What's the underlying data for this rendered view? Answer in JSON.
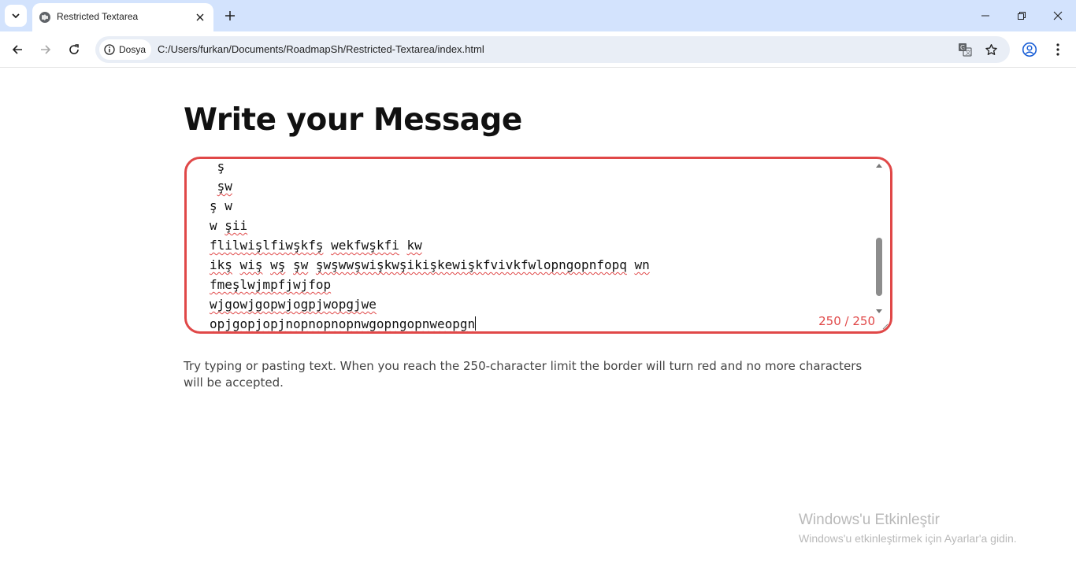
{
  "browser": {
    "tab_title": "Restricted Textarea",
    "site_chip_label": "Dosya",
    "url": "C:/Users/furkan/Documents/RoadmapSh/Restricted-Textarea/index.html"
  },
  "page": {
    "title": "Write your Message",
    "textarea_lines": [
      [
        {
          "t": " ",
          "s": false
        },
        {
          "t": "ş",
          "s": false
        }
      ],
      [
        {
          "t": " ",
          "s": false
        },
        {
          "t": "şw",
          "s": true
        }
      ],
      [
        {
          "t": "ş",
          "s": false
        },
        {
          "t": " ",
          "s": false
        },
        {
          "t": "w",
          "s": false
        }
      ],
      [
        {
          "t": "w",
          "s": false
        },
        {
          "t": " ",
          "s": false
        },
        {
          "t": "şii",
          "s": true
        }
      ],
      [
        {
          "t": "flilwişlfiwşkfş",
          "s": true
        },
        {
          "t": " ",
          "s": false
        },
        {
          "t": "wekfwşkfi",
          "s": true
        },
        {
          "t": " ",
          "s": false
        },
        {
          "t": "kw",
          "s": true
        }
      ],
      [
        {
          "t": "ikş",
          "s": true
        },
        {
          "t": " ",
          "s": false
        },
        {
          "t": "wiş",
          "s": true
        },
        {
          "t": " ",
          "s": false
        },
        {
          "t": "wş",
          "s": true
        },
        {
          "t": " ",
          "s": false
        },
        {
          "t": "şw",
          "s": true
        },
        {
          "t": " ",
          "s": false
        },
        {
          "t": "şwşwwşwişkwşikişkewişkfvivkfwlopngopnfopq",
          "s": true
        },
        {
          "t": " ",
          "s": false
        },
        {
          "t": "wn",
          "s": true
        }
      ],
      [
        {
          "t": "fmeşlwjmpfjwjfop",
          "s": true
        }
      ],
      [
        {
          "t": "wjgowjgopwjogpjwopgjwe",
          "s": true
        }
      ],
      [
        {
          "t": "opjgopjopjnopnopnopnwgopngopnweopgn",
          "s": true
        }
      ]
    ],
    "counter": "250 / 250",
    "help_text": "Try typing or pasting text. When you reach the 250-character limit the border will turn red and no more characters will be accepted.",
    "limit_color": "#e04848"
  },
  "watermark": {
    "title": "Windows'u Etkinleştir",
    "subtitle": "Windows'u etkinleştirmek için Ayarlar'a gidin."
  },
  "icons": [
    "tab-search-icon",
    "globe-icon",
    "close-icon",
    "plus-icon",
    "minimize-icon",
    "restore-icon",
    "close-window-icon",
    "back-arrow-icon",
    "forward-arrow-icon",
    "reload-icon",
    "info-icon",
    "translate-icon",
    "star-icon",
    "profile-icon",
    "kebab-menu-icon"
  ]
}
